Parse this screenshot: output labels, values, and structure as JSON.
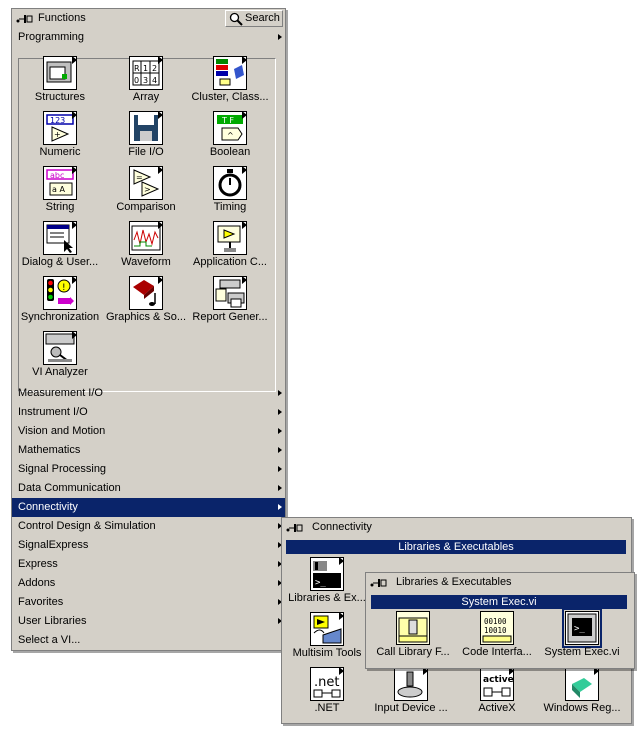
{
  "functions": {
    "title": "Functions",
    "search_label": "Search",
    "categories_top": [
      "Programming"
    ],
    "tiles": [
      {
        "label": "Structures"
      },
      {
        "label": "Array"
      },
      {
        "label": "Cluster, Class..."
      },
      {
        "label": "Numeric"
      },
      {
        "label": "File I/O"
      },
      {
        "label": "Boolean"
      },
      {
        "label": "String"
      },
      {
        "label": "Comparison"
      },
      {
        "label": "Timing"
      },
      {
        "label": "Dialog & User..."
      },
      {
        "label": "Waveform"
      },
      {
        "label": "Application C..."
      },
      {
        "label": "Synchronization"
      },
      {
        "label": "Graphics & So..."
      },
      {
        "label": "Report Gener..."
      },
      {
        "label": "VI Analyzer"
      }
    ],
    "categories": [
      {
        "label": "Measurement I/O"
      },
      {
        "label": "Instrument I/O"
      },
      {
        "label": "Vision and Motion"
      },
      {
        "label": "Mathematics"
      },
      {
        "label": "Signal Processing"
      },
      {
        "label": "Data Communication"
      },
      {
        "label": "Connectivity"
      },
      {
        "label": "Control Design & Simulation"
      },
      {
        "label": "SignalExpress"
      },
      {
        "label": "Express"
      },
      {
        "label": "Addons"
      },
      {
        "label": "Favorites"
      },
      {
        "label": "User Libraries"
      },
      {
        "label": "Select a VI..."
      }
    ]
  },
  "connectivity": {
    "title": "Connectivity",
    "section": "Libraries & Executables",
    "tiles": [
      {
        "label": "Libraries & Ex..."
      },
      {
        "label": "Multisim Tools"
      },
      {
        "label": ".NET"
      },
      {
        "label": "Input Device ..."
      },
      {
        "label": "ActiveX"
      },
      {
        "label": "Windows Reg..."
      }
    ]
  },
  "libexec": {
    "title": "Libraries & Executables",
    "section": "System Exec.vi",
    "tiles": [
      {
        "label": "Call Library F..."
      },
      {
        "label": "Code Interfa..."
      },
      {
        "label": "System Exec.vi"
      }
    ]
  }
}
